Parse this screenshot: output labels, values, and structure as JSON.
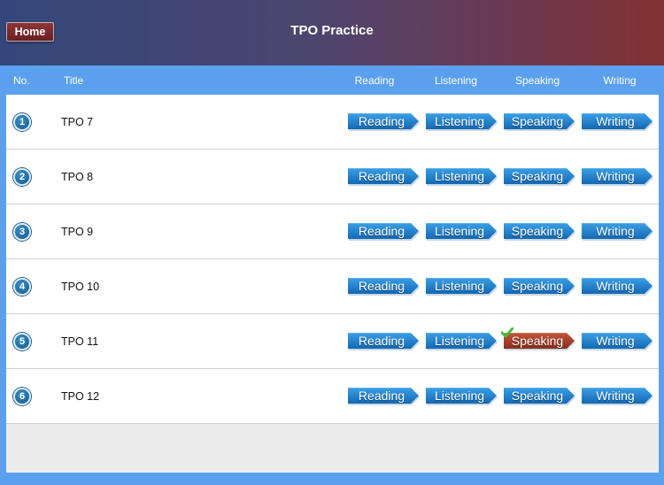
{
  "app": {
    "home_label": "Home",
    "title": "TPO Practice"
  },
  "columns": {
    "no": "No.",
    "title": "Title",
    "reading": "Reading",
    "listening": "Listening",
    "speaking": "Speaking",
    "writing": "Writing"
  },
  "colors": {
    "button_blue": "#1f86d1",
    "button_completed": "#a3402a",
    "header_blue": "#5aa0ee"
  },
  "rows": [
    {
      "num": "1",
      "title": "TPO 7",
      "reading": "Reading",
      "listening": "Listening",
      "speaking": "Speaking",
      "writing": "Writing",
      "completed": []
    },
    {
      "num": "2",
      "title": "TPO 8",
      "reading": "Reading",
      "listening": "Listening",
      "speaking": "Speaking",
      "writing": "Writing",
      "completed": []
    },
    {
      "num": "3",
      "title": "TPO 9",
      "reading": "Reading",
      "listening": "Listening",
      "speaking": "Speaking",
      "writing": "Writing",
      "completed": []
    },
    {
      "num": "4",
      "title": "TPO 10",
      "reading": "Reading",
      "listening": "Listening",
      "speaking": "Speaking",
      "writing": "Writing",
      "completed": []
    },
    {
      "num": "5",
      "title": "TPO 11",
      "reading": "Reading",
      "listening": "Listening",
      "speaking": "Speaking",
      "writing": "Writing",
      "completed": [
        "speaking"
      ]
    },
    {
      "num": "6",
      "title": "TPO 12",
      "reading": "Reading",
      "listening": "Listening",
      "speaking": "Speaking",
      "writing": "Writing",
      "completed": []
    }
  ]
}
